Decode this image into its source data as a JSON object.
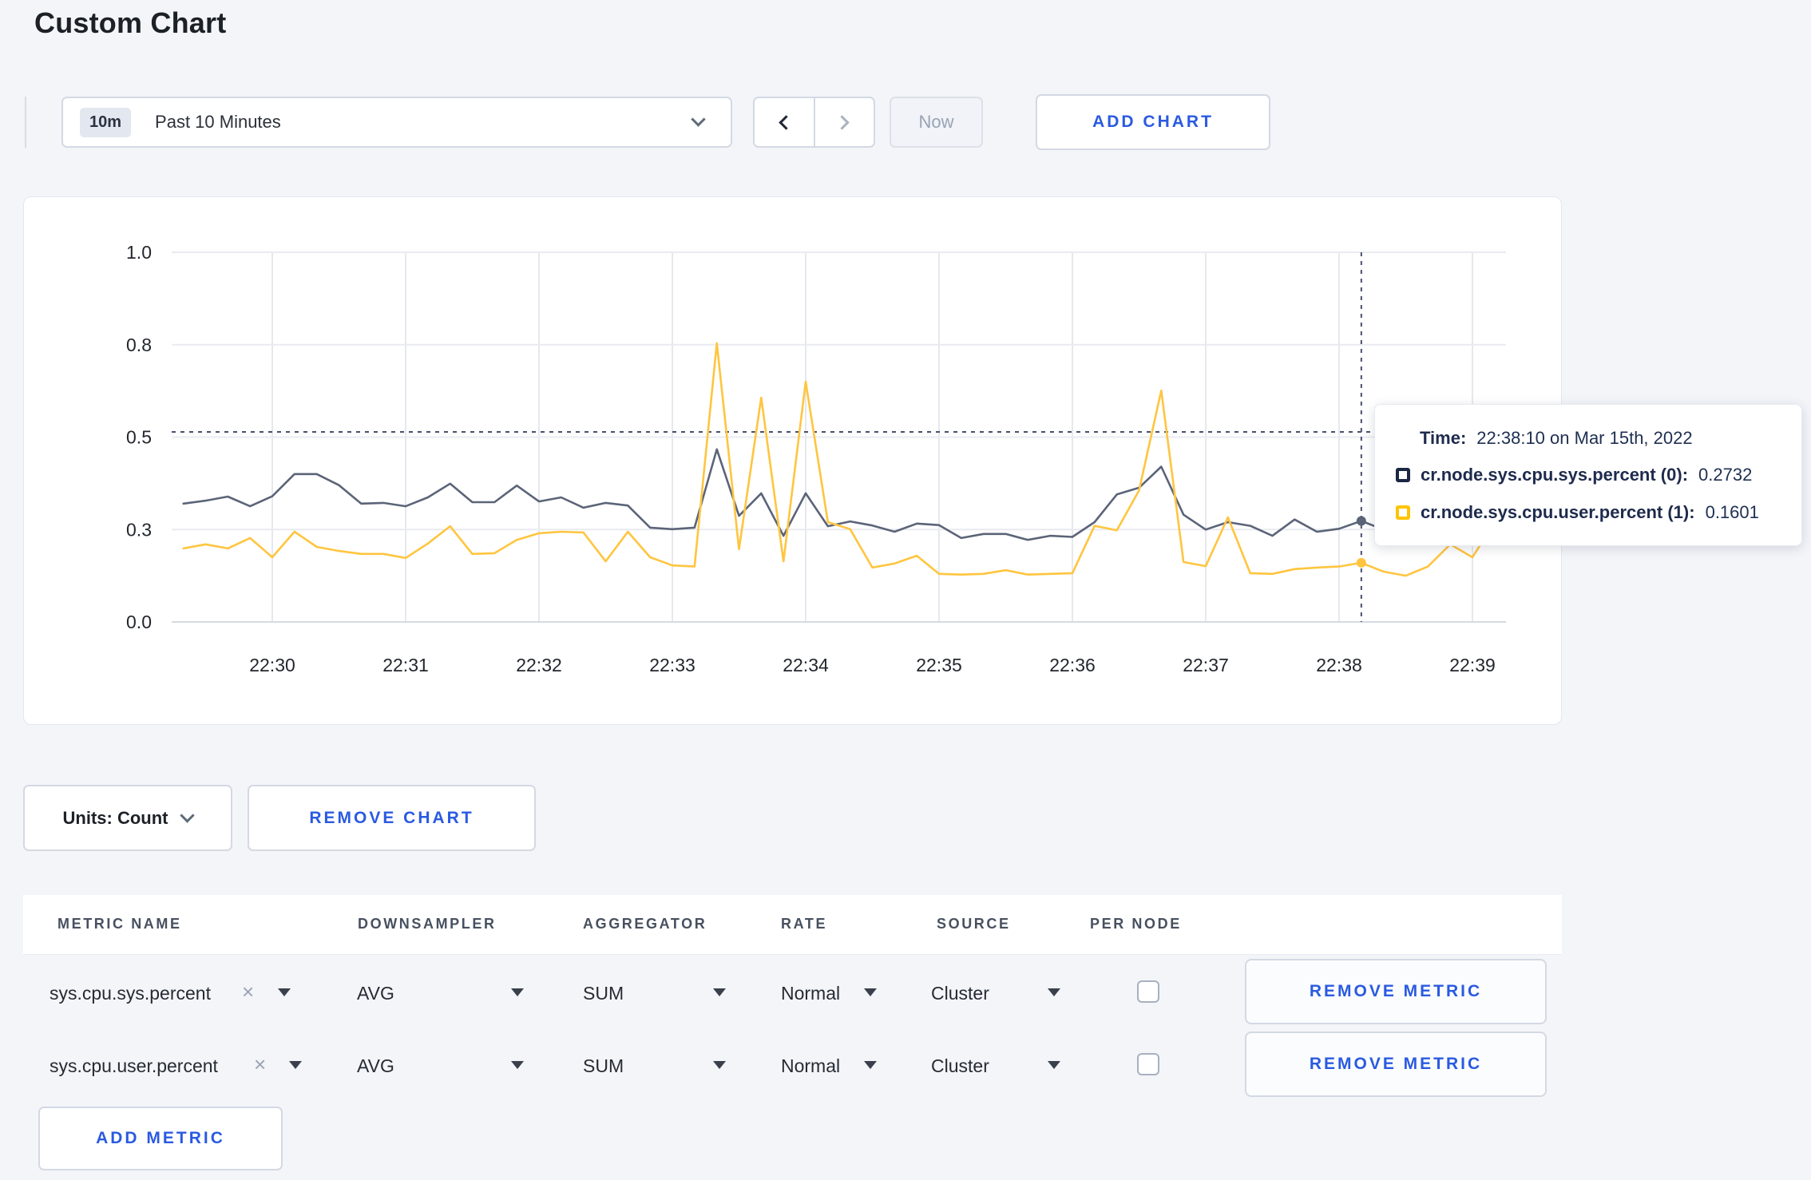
{
  "page": {
    "title": "Custom Chart",
    "background": "#f3f5f9",
    "accent_blue": "#2a5ae0"
  },
  "toolbar": {
    "range_badge": "10m",
    "range_label": "Past 10 Minutes",
    "now_label": "Now",
    "add_chart_label": "ADD CHART"
  },
  "icons": {
    "time_range_chevron": "chevron-down",
    "prev": "chevron-left",
    "next": "chevron-right",
    "units_chevron": "chevron-down",
    "metric_clear": "×",
    "select_caret": "triangle-down",
    "series_swatches": [
      "square-outline-navy",
      "square-outline-yellow"
    ]
  },
  "chart_data": {
    "type": "line",
    "title": "",
    "xlabel": "",
    "ylabel": "",
    "ylim": [
      0,
      1.0
    ],
    "grid": true,
    "legend_position": "tooltip",
    "x_tick_labels": [
      "22:30",
      "22:31",
      "22:32",
      "22:33",
      "22:34",
      "22:35",
      "22:36",
      "22:37",
      "22:38",
      "22:39"
    ],
    "y_tick_labels": [
      "0.0",
      "0.3",
      "0.5",
      "0.8",
      "1.0"
    ],
    "y_gridline_values": [
      0,
      0.25,
      0.5,
      0.75,
      1.0
    ],
    "x_start": "22:29:20",
    "x_interval_seconds": 10,
    "series": [
      {
        "name": "cr.node.sys.cpu.sys.percent",
        "color": "#5b6478",
        "values": [
          0.32,
          0.328,
          0.339,
          0.313,
          0.34,
          0.4,
          0.4,
          0.37,
          0.32,
          0.322,
          0.313,
          0.337,
          0.374,
          0.324,
          0.324,
          0.369,
          0.326,
          0.337,
          0.309,
          0.322,
          0.315,
          0.255,
          0.251,
          0.255,
          0.467,
          0.287,
          0.348,
          0.233,
          0.348,
          0.259,
          0.272,
          0.261,
          0.244,
          0.266,
          0.262,
          0.227,
          0.238,
          0.238,
          0.222,
          0.233,
          0.23,
          0.27,
          0.345,
          0.363,
          0.42,
          0.29,
          0.25,
          0.27,
          0.26,
          0.233,
          0.277,
          0.244,
          0.252,
          0.2732,
          0.25,
          0.24,
          0.25,
          0.262,
          0.255,
          0.26
        ]
      },
      {
        "name": "cr.node.sys.cpu.user.percent",
        "color": "#ffc53f",
        "values": [
          0.199,
          0.21,
          0.199,
          0.227,
          0.175,
          0.244,
          0.203,
          0.192,
          0.184,
          0.184,
          0.173,
          0.212,
          0.259,
          0.184,
          0.186,
          0.222,
          0.24,
          0.244,
          0.242,
          0.164,
          0.244,
          0.175,
          0.153,
          0.15,
          0.754,
          0.197,
          0.607,
          0.164,
          0.65,
          0.27,
          0.251,
          0.147,
          0.158,
          0.179,
          0.13,
          0.128,
          0.13,
          0.14,
          0.128,
          0.13,
          0.132,
          0.26,
          0.248,
          0.356,
          0.626,
          0.162,
          0.151,
          0.283,
          0.132,
          0.13,
          0.143,
          0.147,
          0.15,
          0.1601,
          0.136,
          0.125,
          0.15,
          0.21,
          0.175,
          0.27
        ]
      }
    ],
    "crosshair": {
      "time": "22:38:10",
      "x_index": 53,
      "y_value": 0.514
    },
    "hover_points": [
      {
        "series": 0,
        "value": 0.2732
      },
      {
        "series": 1,
        "value": 0.1601
      }
    ]
  },
  "tooltip": {
    "time_label": "Time:",
    "time_value": "22:38:10 on Mar 15th, 2022",
    "series": [
      {
        "label": "cr.node.sys.cpu.sys.percent (0):",
        "value": "0.2732",
        "swatch_color": "#1b2644"
      },
      {
        "label": "cr.node.sys.cpu.user.percent (1):",
        "value": "0.1601",
        "swatch_color": "#ffc400"
      }
    ]
  },
  "chart_footer": {
    "units_label": "Units: Count",
    "remove_chart_label": "REMOVE CHART"
  },
  "metrics_table": {
    "headers": [
      "METRIC NAME",
      "DOWNSAMPLER",
      "AGGREGATOR",
      "RATE",
      "SOURCE",
      "PER NODE"
    ],
    "rows": [
      {
        "metric": "sys.cpu.sys.percent",
        "downsampler": "AVG",
        "aggregator": "SUM",
        "rate": "Normal",
        "source": "Cluster",
        "per_node_checked": false,
        "remove_label": "REMOVE METRIC"
      },
      {
        "metric": "sys.cpu.user.percent",
        "downsampler": "AVG",
        "aggregator": "SUM",
        "rate": "Normal",
        "source": "Cluster",
        "per_node_checked": false,
        "remove_label": "REMOVE METRIC"
      }
    ],
    "add_metric_label": "ADD METRIC"
  }
}
